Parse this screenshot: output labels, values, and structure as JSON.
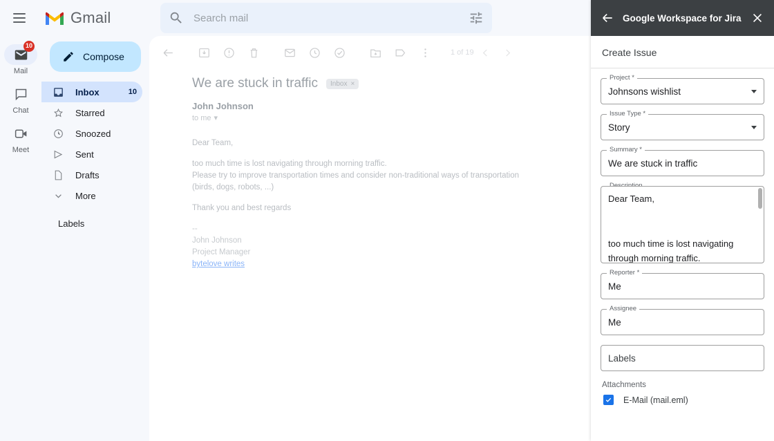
{
  "topbar": {
    "menu_icon": "hamburger-icon",
    "brand": "Gmail",
    "search_placeholder": "Search mail",
    "search_value": "",
    "search_icon": "search-icon",
    "filter_icon": "tune-icon",
    "help_icon": "help-icon",
    "settings_icon": "gear-icon",
    "apps_icon": "apps-grid-icon"
  },
  "rail": {
    "items": [
      {
        "label": "Mail",
        "icon": "mail-icon",
        "badge": "10",
        "active": true
      },
      {
        "label": "Chat",
        "icon": "chat-icon",
        "badge": "",
        "active": false
      },
      {
        "label": "Meet",
        "icon": "meet-icon",
        "badge": "",
        "active": false
      }
    ]
  },
  "nav": {
    "compose_label": "Compose",
    "compose_icon": "pencil-icon",
    "items": [
      {
        "label": "Inbox",
        "icon": "inbox-icon",
        "count": "10",
        "active": true
      },
      {
        "label": "Starred",
        "icon": "star-icon",
        "count": "",
        "active": false
      },
      {
        "label": "Snoozed",
        "icon": "clock-icon",
        "count": "",
        "active": false
      },
      {
        "label": "Sent",
        "icon": "send-icon",
        "count": "",
        "active": false
      },
      {
        "label": "Drafts",
        "icon": "draft-icon",
        "count": "",
        "active": false
      },
      {
        "label": "More",
        "icon": "chevron-down-icon",
        "count": "",
        "active": false
      }
    ],
    "labels_header": "Labels"
  },
  "mail": {
    "toolbar_icons": [
      "back-icon",
      "archive-icon",
      "report-spam-icon",
      "delete-icon",
      "mark-unread-icon",
      "snooze-icon",
      "add-to-tasks-icon",
      "move-to-icon",
      "labels-icon",
      "more-options-icon"
    ],
    "pagination": "1 of 19",
    "prev_icon": "chevron-left-icon",
    "next_icon": "chevron-right-icon",
    "subject": "We are stuck in traffic",
    "label_chip": "Inbox",
    "label_chip_remove": "×",
    "print_icon": "print-icon",
    "open_in_new_icon": "open-in-new-icon",
    "sender": "John Johnson",
    "recipient": "to me",
    "recipient_caret": "▾",
    "star_icon": "star-outline-icon",
    "reply_icon": "reply-icon",
    "more_icon": "more-vert-icon",
    "body": {
      "greeting": "Dear Team,",
      "para1_line1": "too much time is lost navigating through morning traffic.",
      "para1_line2": "Please try to improve transportation times and consider non-traditional ways of transportation",
      "para1_line3": "(birds, dogs, robots, ...)",
      "closing": "Thank you and best regards",
      "sig_dashes": "--",
      "sig_name": "John Johnson",
      "sig_role": "Project Manager",
      "sig_link": "bytelove writes"
    }
  },
  "addons": {
    "items": [
      {
        "name": "google-calendar-icon",
        "active": false
      },
      {
        "name": "google-keep-icon",
        "active": false
      },
      {
        "name": "google-tasks-icon",
        "active": false
      },
      {
        "name": "google-contacts-icon",
        "active": false
      },
      {
        "name": "jira-addon-icon",
        "active": true
      },
      {
        "name": "add-addon-icon",
        "active": false
      }
    ]
  },
  "jira": {
    "back_icon": "back-arrow-icon",
    "title": "Google Workspace for Jira",
    "close_icon": "close-icon",
    "section_title": "Create Issue",
    "fields": [
      {
        "label": "Project *",
        "value": "Johnsons wishlist",
        "type": "select"
      },
      {
        "label": "Issue Type *",
        "value": "Story",
        "type": "select"
      },
      {
        "label": "Summary *",
        "value": "We are stuck in traffic",
        "type": "text"
      }
    ],
    "description": {
      "label": "Description",
      "value": "Dear Team,\n\n\ntoo much time is lost navigating\nthrough morning traffic.\nPlease try to improve transportation"
    },
    "fields2": [
      {
        "label": "Reporter *",
        "value": "Me",
        "type": "text"
      },
      {
        "label": "Assignee",
        "value": "Me",
        "type": "text"
      }
    ],
    "labels_field": {
      "label": "",
      "value": "Labels",
      "type": "text"
    },
    "attachments_header": "Attachments",
    "attachment": {
      "name": "E-Mail (mail.eml)",
      "checked": true
    },
    "accent_color": "#1a73e8",
    "header_color": "#3c4043"
  }
}
